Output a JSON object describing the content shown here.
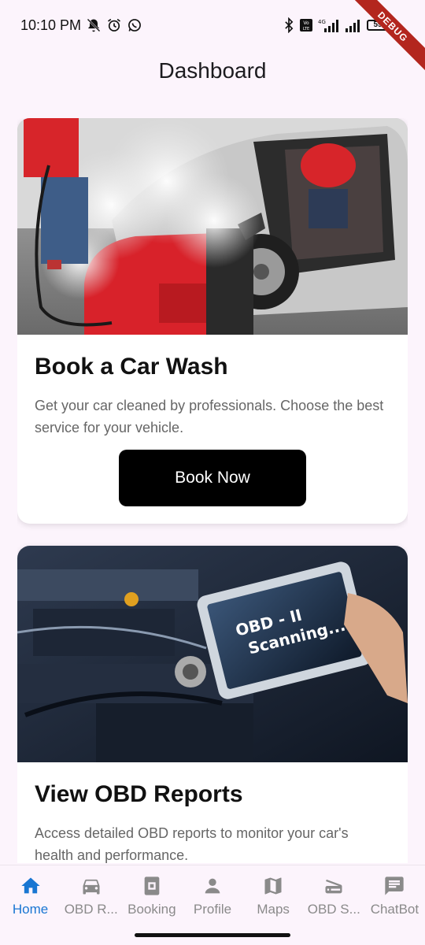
{
  "status_bar": {
    "time": "10:10 PM",
    "battery": "59",
    "debug_label": "DEBUG"
  },
  "app_bar": {
    "title": "Dashboard"
  },
  "cards": [
    {
      "title": "Book a Car Wash",
      "description": "Get your car cleaned by professionals. Choose the best service for your vehicle.",
      "button_label": "Book Now",
      "image_icon": "car-wash-photo"
    },
    {
      "title": "View OBD Reports",
      "description": "Access detailed OBD reports to monitor your car's health and performance.",
      "image_text_line1": "OBD - II",
      "image_text_line2": "Scanning....",
      "image_icon": "obd-scanner-photo"
    }
  ],
  "bottom_nav": {
    "items": [
      {
        "label": "Home",
        "icon": "home-icon",
        "active": true
      },
      {
        "label": "OBD R...",
        "icon": "car-icon",
        "active": false
      },
      {
        "label": "Booking",
        "icon": "booking-icon",
        "active": false
      },
      {
        "label": "Profile",
        "icon": "person-icon",
        "active": false
      },
      {
        "label": "Maps",
        "icon": "map-icon",
        "active": false
      },
      {
        "label": "OBD S...",
        "icon": "scanner-icon",
        "active": false
      },
      {
        "label": "ChatBot",
        "icon": "chat-icon",
        "active": false
      }
    ]
  },
  "colors": {
    "background": "#fcf4fc",
    "active_nav": "#1976d2",
    "inactive_nav": "#8a8a8a",
    "button": "#000000"
  }
}
